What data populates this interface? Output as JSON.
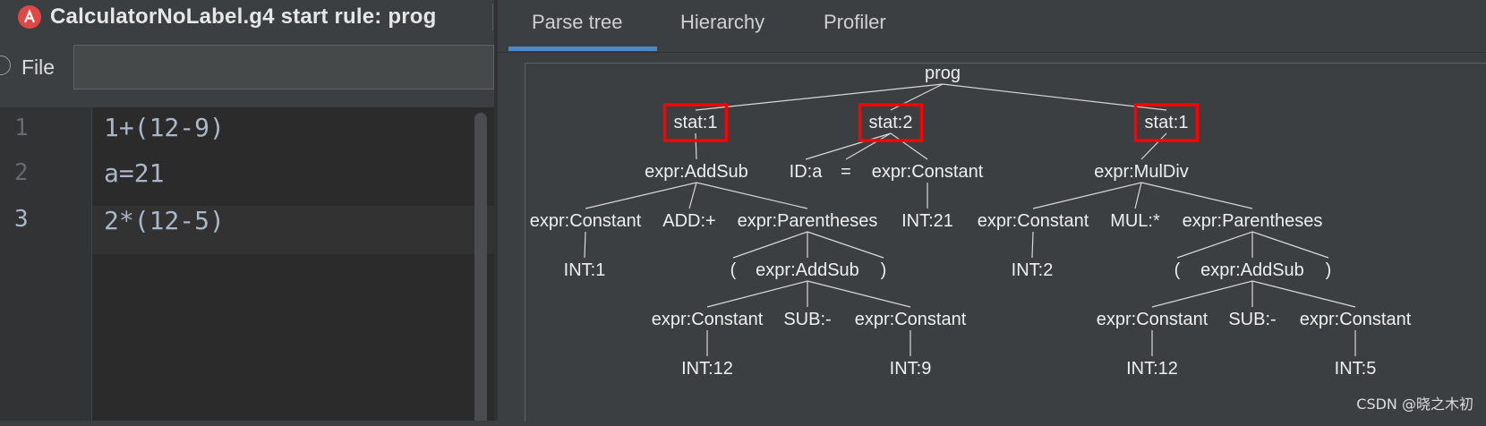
{
  "window": {
    "title": "CalculatorNoLabel.g4 start rule: prog",
    "icon": "antlr-icon"
  },
  "input": {
    "file_label": "File",
    "file_value": ""
  },
  "editor": {
    "lines": [
      {
        "num": "1",
        "code": "1+(12-9)"
      },
      {
        "num": "2",
        "code": "a=21"
      },
      {
        "num": "3",
        "code": "2*(12-5)"
      }
    ],
    "current_line": 3
  },
  "tabs": [
    "Parse tree",
    "Hierarchy",
    "Profiler"
  ],
  "active_tab": "Parse tree",
  "tree": {
    "nodes": {
      "prog": "prog",
      "stat1": "stat:1",
      "stat2": "stat:2",
      "stat3": "stat:1",
      "addsub1": "expr:AddSub",
      "c1": "expr:Constant",
      "add": "ADD:+",
      "par1": "expr:Parentheses",
      "int1": "INT:1",
      "lp1": "(",
      "addsub2": "expr:AddSub",
      "rp1": ")",
      "c12a": "expr:Constant",
      "sub1": "SUB:-",
      "c9": "expr:Constant",
      "int12a": "INT:12",
      "int9": "INT:9",
      "ida": "ID:a",
      "eq": "=",
      "c21": "expr:Constant",
      "int21": "INT:21",
      "muldiv": "expr:MulDiv",
      "c2": "expr:Constant",
      "mul": "MUL:*",
      "par2": "expr:Parentheses",
      "int2": "INT:2",
      "lp2": "(",
      "addsub3": "expr:AddSub",
      "rp2": ")",
      "c12b": "expr:Constant",
      "sub2": "SUB:-",
      "c5": "expr:Constant",
      "int12b": "INT:12",
      "int5": "INT:5"
    },
    "highlighted": [
      "stat1",
      "stat2",
      "stat3"
    ],
    "highlight_color": "#ff0000"
  },
  "watermark": "CSDN @晓之木初"
}
